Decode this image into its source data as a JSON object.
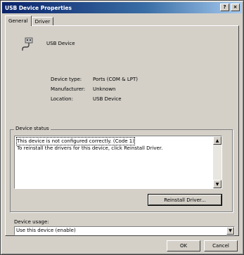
{
  "window": {
    "title": "USB Device Properties",
    "help_button": "?",
    "close_button": "×"
  },
  "tabs": [
    {
      "label": "General",
      "active": true
    },
    {
      "label": "Driver",
      "active": false
    }
  ],
  "device": {
    "name": "USB Device",
    "icon": "usb-device-icon"
  },
  "info": [
    {
      "label": "Device type:",
      "value": "Ports (COM & LPT)"
    },
    {
      "label": "Manufacturer:",
      "value": "Unknown"
    },
    {
      "label": "Location:",
      "value": "USB Device"
    }
  ],
  "status": {
    "group_label": "Device status",
    "line1": "This device is not configured correctly. (Code 1)",
    "line2": "To reinstall the drivers for this device, click Reinstall Driver.",
    "reinstall_button": "Reinstall Driver..."
  },
  "usage": {
    "label": "Device usage:",
    "value": "Use this device (enable)"
  },
  "footer": {
    "ok": "OK",
    "cancel": "Cancel"
  }
}
